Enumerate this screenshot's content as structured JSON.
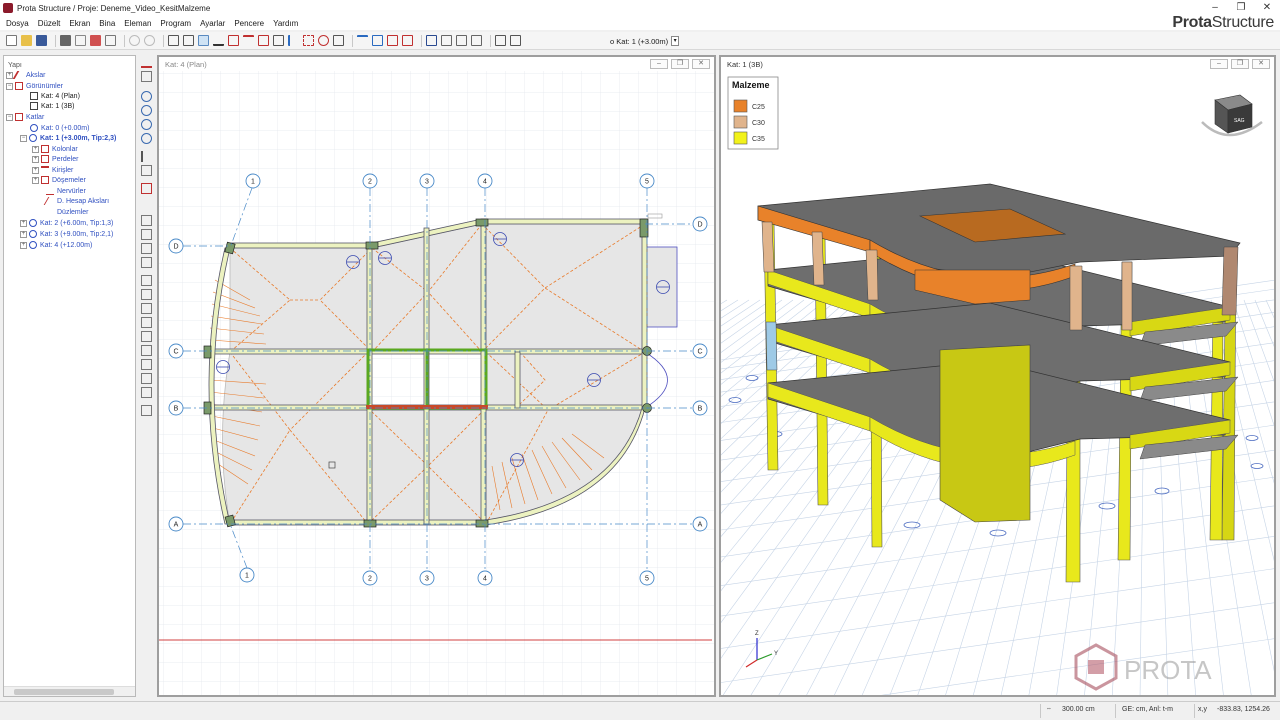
{
  "window": {
    "title": "Prota Structure / Proje: Deneme_Video_KesitMalzeme",
    "minimize": "–",
    "maximize": "❐",
    "close": "✕"
  },
  "menu": [
    "Dosya",
    "Düzelt",
    "Ekran",
    "Bina",
    "Eleman",
    "Program",
    "Ayarlar",
    "Pencere",
    "Yardım"
  ],
  "brand": {
    "part1": "Prota",
    "part2": "Structure"
  },
  "toolbar": {
    "floor_select": "Kat: 1 (+3.00m)",
    "floor_prefix": "o"
  },
  "tree": {
    "root": "Yapı",
    "aks": "Akslar",
    "views": "Görünümler",
    "view1": "Kat: 4 (Plan)",
    "view2": "Kat: 1 (3B)",
    "floors": "Katlar",
    "floor0": "Kat: 0 (+0.00m)",
    "floor1": "Kat: 1 (+3.00m, Tip:2,3)",
    "cols": "Kolonlar",
    "walls": "Perdeler",
    "beams": "Kirişler",
    "slabs": "Döşemeler",
    "ribs": "Nervürler",
    "daxes": "D. Hesap Aksları",
    "regs": "Düzlemler",
    "floor2": "Kat: 2 (+6.00m, Tip:1,3)",
    "floor3": "Kat: 3 (+9.00m, Tip:2,1)",
    "floor4": "Kat: 4 (+12.00m)"
  },
  "plan": {
    "title": "Kat: 4 (Plan)",
    "axes_top": [
      "1",
      "2",
      "3",
      "4",
      "5"
    ],
    "axes_side": [
      "D",
      "C",
      "B",
      "A"
    ]
  },
  "view3d": {
    "title": "Kat: 1 (3B)",
    "legend_title": "Malzeme",
    "legend": [
      {
        "label": "C25",
        "color": "#e8822a"
      },
      {
        "label": "C30",
        "color": "#e0b48c"
      },
      {
        "label": "C35",
        "color": "#f2f21a"
      }
    ],
    "cube_label": "SAG",
    "axis_z": "Z",
    "axis_y": "Y",
    "watermark": "PROTA"
  },
  "status": {
    "scale": "300.00 cm",
    "units": "GE: cm, Anl: t-m",
    "coord_label": "x,y",
    "coords": "-833.83, 1254.26"
  },
  "colors": {
    "accent": "#3050c0",
    "brand": "#8b1a2b"
  }
}
